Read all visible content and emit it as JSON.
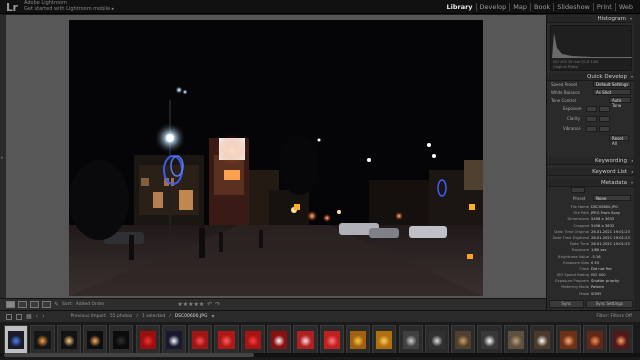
{
  "app": {
    "logo": "Lr",
    "user_line": "Adobe Lightroom",
    "mobile_prompt": "Get started with Lightroom mobile ▸"
  },
  "modules": [
    {
      "label": "Library",
      "active": true
    },
    {
      "label": "Develop",
      "active": false
    },
    {
      "label": "Map",
      "active": false
    },
    {
      "label": "Book",
      "active": false
    },
    {
      "label": "Slideshow",
      "active": false
    },
    {
      "label": "Print",
      "active": false
    },
    {
      "label": "Web",
      "active": false
    }
  ],
  "toolbar": {
    "sort_label": "Sort:",
    "sort_value": "Added Order",
    "stars": "★★★★★"
  },
  "right_panel": {
    "histogram_title": "Histogram",
    "histogram_info": "ISO 400   35 mm   f/1.8   1/60",
    "original_photo_label": "Original Photo",
    "quick_develop_title": "Quick Develop",
    "saved_preset_label": "Saved Preset",
    "saved_preset_value": "Default Settings",
    "white_balance_label": "White Balance",
    "white_balance_value": "As Shot",
    "tone_control_label": "Tone Control",
    "tone_control_value": "Auto Tone",
    "exposure_label": "Exposure",
    "clarity_label": "Clarity",
    "vibrance_label": "Vibrance",
    "reset_label": "Reset All",
    "keywording_title": "Keywording",
    "keyword_list_title": "Keyword List",
    "metadata_title": "Metadata",
    "metadata_preset_label": "Preset",
    "metadata_preset_value": "None",
    "metadata_rows": [
      {
        "key": "File Name",
        "value": "DSC00600.JPG"
      },
      {
        "key": "File Path",
        "value": "JPEG From Sony"
      },
      {
        "key": "Dimensions",
        "value": "5456 x 3632"
      },
      {
        "key": "Cropped",
        "value": "5456 x 3632"
      },
      {
        "key": "Date Time Original",
        "value": "26.01.2021 19:01:23"
      },
      {
        "key": "Date Time Digitized",
        "value": "26.01.2021 19:01:23"
      },
      {
        "key": "Date Time",
        "value": "26.01.2021 19:01:23"
      },
      {
        "key": "Exposure",
        "value": "1/60 sec"
      },
      {
        "key": "Brightness Value",
        "value": "-5.16"
      },
      {
        "key": "Exposure Bias",
        "value": "0 EV"
      },
      {
        "key": "Flash",
        "value": "Did not fire"
      },
      {
        "key": "ISO Speed Rating",
        "value": "ISO 400"
      },
      {
        "key": "Exposure Program",
        "value": "Shutter priority"
      },
      {
        "key": "Metering Mode",
        "value": "Pattern"
      },
      {
        "key": "Make",
        "value": "SONY"
      }
    ],
    "sync_label": "Sync",
    "sync_settings_label": "Sync Settings"
  },
  "filmstrip_bar": {
    "previous_import": "Previous Import",
    "photo_count": "55 photos",
    "selected_label": "1 selected",
    "selected_file": "DSC00600.JPG",
    "filter_label": "Filter:",
    "filter_value": "Filters Off"
  },
  "filmstrip": [
    {
      "selected": true,
      "color": "#1a1a2a",
      "accent": "#5080ff"
    },
    {
      "selected": false,
      "color": "#151515",
      "accent": "#ffa040"
    },
    {
      "selected": false,
      "color": "#121212",
      "accent": "#ffd080"
    },
    {
      "selected": false,
      "color": "#0e0e0e",
      "accent": "#ffb060"
    },
    {
      "selected": false,
      "color": "#0b0b0b",
      "accent": "#303030"
    },
    {
      "selected": false,
      "color": "#9a1010",
      "accent": "#ff3030"
    },
    {
      "selected": false,
      "color": "#181830",
      "accent": "#ffffff"
    },
    {
      "selected": false,
      "color": "#a01515",
      "accent": "#ff5050"
    },
    {
      "selected": false,
      "color": "#b01818",
      "accent": "#ff6060"
    },
    {
      "selected": false,
      "color": "#a81414",
      "accent": "#ff4040"
    },
    {
      "selected": false,
      "color": "#8a1010",
      "accent": "#ffffff"
    },
    {
      "selected": false,
      "color": "#b02020",
      "accent": "#ffdddd"
    },
    {
      "selected": false,
      "color": "#c02020",
      "accent": "#ff8080"
    },
    {
      "selected": false,
      "color": "#a06010",
      "accent": "#ffcc40"
    },
    {
      "selected": false,
      "color": "#b07010",
      "accent": "#ffd060"
    },
    {
      "selected": false,
      "color": "#404040",
      "accent": "#d0d0d0"
    },
    {
      "selected": false,
      "color": "#303030",
      "accent": "#e0e0e0"
    },
    {
      "selected": false,
      "color": "#504030",
      "accent": "#d0a060"
    },
    {
      "selected": false,
      "color": "#383838",
      "accent": "#ffffff"
    },
    {
      "selected": false,
      "color": "#605040",
      "accent": "#c0a080"
    },
    {
      "selected": false,
      "color": "#4a3a2a",
      "accent": "#ffffff"
    },
    {
      "selected": false,
      "color": "#703018",
      "accent": "#ffb070"
    },
    {
      "selected": false,
      "color": "#602818",
      "accent": "#ff9050"
    },
    {
      "selected": false,
      "color": "#501818",
      "accent": "#ffa060"
    }
  ]
}
